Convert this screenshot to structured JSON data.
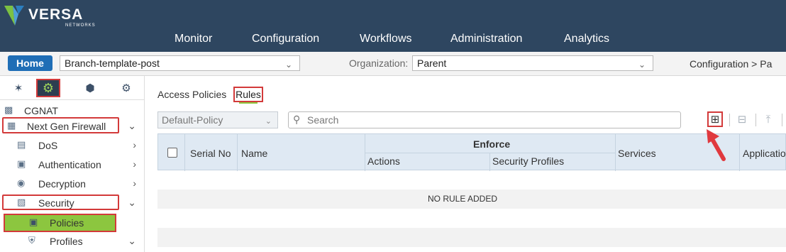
{
  "brand": {
    "name": "VERSA",
    "sub": "NETWORKS"
  },
  "top_nav": [
    "Monitor",
    "Configuration",
    "Workflows",
    "Administration",
    "Analytics"
  ],
  "context": {
    "home_label": "Home",
    "template_value": "Branch-template-post",
    "org_label": "Organization:",
    "org_value": "Parent",
    "breadcrumb": "Configuration  >  Pa"
  },
  "sidebar": {
    "icon_tabs": [
      "network-icon",
      "gear-icon",
      "cube-icon",
      "globe-gear-icon"
    ],
    "items": [
      {
        "label": "CGNAT",
        "icon": "cgnat-icon"
      },
      {
        "label": "Next Gen Firewall",
        "icon": "firewall-icon"
      },
      {
        "label": "DoS",
        "icon": "dos-icon"
      },
      {
        "label": "Authentication",
        "icon": "auth-icon"
      },
      {
        "label": "Decryption",
        "icon": "lock-icon"
      },
      {
        "label": "Security",
        "icon": "security-icon"
      },
      {
        "label": "Policies",
        "icon": "policy-icon"
      },
      {
        "label": "Profiles",
        "icon": "shield-icon"
      }
    ]
  },
  "subtabs": {
    "access_policies": "Access Policies",
    "rules": "Rules"
  },
  "toolbar": {
    "policy_value": "Default-Policy",
    "search_placeholder": "Search"
  },
  "table": {
    "headers": {
      "serial": "Serial No",
      "name": "Name",
      "enforce": "Enforce",
      "actions": "Actions",
      "security_profiles": "Security Profiles",
      "services": "Services",
      "applications": "Applicatio"
    },
    "empty_message": "NO RULE ADDED"
  },
  "colors": {
    "header_bg": "#2e4660",
    "accent_green": "#8cc63f",
    "home_blue": "#1f6eb6",
    "highlight_red": "#d33a3a"
  }
}
